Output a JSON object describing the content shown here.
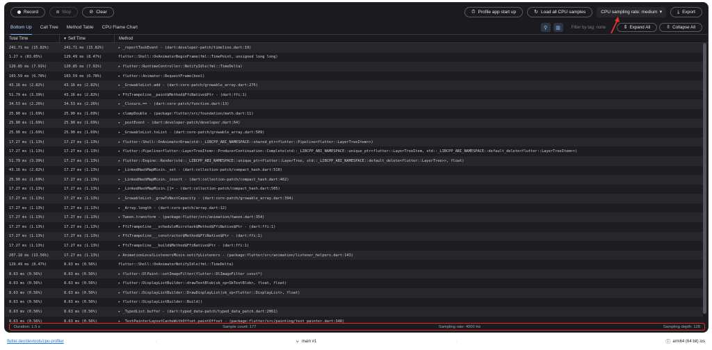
{
  "toolbar": {
    "record": "Record",
    "stop": "Stop",
    "clear": "Clear",
    "profile_startup": "Profile app start up",
    "load_all": "Load all CPU samples",
    "sampling_rate": "CPU sampling rate: medium",
    "export": "Export"
  },
  "tabs": [
    "Bottom Up",
    "Call Tree",
    "Method Table",
    "CPU Flame Chart"
  ],
  "filter": {
    "placeholder": "Filter by tag: none"
  },
  "actions": {
    "expand_all": "Expand All",
    "collapse_all": "Collapse All"
  },
  "columns": {
    "total": "Total Time",
    "self": "Self Time",
    "method": "Method"
  },
  "rows": [
    {
      "total": "241.71 ms (15.82%)",
      "self": "241.71 ms (15.82%)",
      "method": "▸ _reportTaskEvent - (dart:developer-patch/timeline.dart:19)"
    },
    {
      "total": "1.27 s (83.05%)",
      "self": "129.49 ms (8.47%)",
      "method": "  flutter::Shell::OnAnimatorBeginFrame(fml::TimePoint, unsigned long long)"
    },
    {
      "total": "120.85 ms (7.91%)",
      "self": "120.85 ms (7.91%)",
      "method": "▸ flutter::RuntimeController::NotifyIdle(fml::TimeDelta)"
    },
    {
      "total": "103.59 ms (6.78%)",
      "self": "103.59 ms (6.78%)",
      "method": "▸ flutter::Animator::RequestFrame(bool)"
    },
    {
      "total": "43.16 ms (2.82%)",
      "self": "43.16 ms (2.82%)",
      "method": "▸ _GrowableList.add - (dart:core-patch/growable_array.dart:275)"
    },
    {
      "total": "51.79 ms (3.39%)",
      "self": "43.16 ms (2.82%)",
      "method": "▸ FfiTrampoline__paint$Method$FfiNative$Ptr - (dart:ffi:1)"
    },
    {
      "total": "34.53 ms (2.26%)",
      "self": "34.53 ms (2.26%)",
      "method": "▸ _Closure.== - (dart:core-patch/function.dart:13)"
    },
    {
      "total": "25.90 ms (1.69%)",
      "self": "25.90 ms (1.69%)",
      "method": "▸ clampDouble - (package:flutter/src/foundation/math.dart:11)"
    },
    {
      "total": "25.90 ms (1.69%)",
      "self": "25.90 ms (1.69%)",
      "method": "▸ _postEvent - (dart:developer-patch/developer.dart:64)"
    },
    {
      "total": "25.90 ms (1.69%)",
      "self": "25.90 ms (1.69%)",
      "method": "▸ _GrowableList.toList - (dart:core-patch/growable_array.dart:509)"
    },
    {
      "total": "17.27 ms (1.13%)",
      "self": "17.27 ms (1.13%)",
      "method": "▸ flutter::Shell::OnAnimatorDraw(std::_LIBCPP_ABI_NAMESPACE::shared_ptr<flutter::Pipeline<flutter::LayerTreeItem>>)"
    },
    {
      "total": "17.27 ms (1.13%)",
      "self": "17.27 ms (1.13%)",
      "method": "▸ flutter::Pipeline<flutter::LayerTreeItem>::ProducerContinuation::Complete(std::_LIBCPP_ABI_NAMESPACE::unique_ptr<flutter::LayerTreeItem, std::_LIBCPP_ABI_NAMESPACE::default_delete<flutter::LayerTreeItem>>)"
    },
    {
      "total": "51.79 ms (3.39%)",
      "self": "17.27 ms (1.13%)",
      "method": "▸ flutter::Engine::Render(std::_LIBCPP_ABI_NAMESPACE::unique_ptr<flutter::LayerTree, std::_LIBCPP_ABI_NAMESPACE::default_delete<flutter::LayerTree>>, float)"
    },
    {
      "total": "43.16 ms (2.82%)",
      "self": "17.27 ms (1.13%)",
      "method": "▸ _LinkedHashMapMixin._set - (dart:collection-patch/compact_hash.dart:510)"
    },
    {
      "total": "25.90 ms (1.69%)",
      "self": "17.27 ms (1.13%)",
      "method": "▸ _LinkedHashMapMixin._insert - (dart:collection-patch/compact_hash.dart:462)"
    },
    {
      "total": "17.27 ms (1.13%)",
      "self": "17.27 ms (1.13%)",
      "method": "▸ _LinkedHashMapMixin.[]= - (dart:collection-patch/compact_hash.dart:505)"
    },
    {
      "total": "17.27 ms (1.13%)",
      "self": "17.27 ms (1.13%)",
      "method": "▸ _GrowableList._growToNextCapacity - (dart:core-patch/growable_array.dart:394)"
    },
    {
      "total": "17.27 ms (1.13%)",
      "self": "17.27 ms (1.13%)",
      "method": "▸ _Array.length - (dart:core-patch/array.dart:12)"
    },
    {
      "total": "17.27 ms (1.13%)",
      "self": "17.27 ms (1.13%)",
      "method": "▸ Tween.transform - (package:flutter/src/animation/tween.dart:354)"
    },
    {
      "total": "17.27 ms (1.13%)",
      "self": "17.27 ms (1.13%)",
      "method": "▸ FfiTrampoline___scheduleMicrotask$Method$FfiNative$Ptr - (dart:ffi:1)"
    },
    {
      "total": "17.27 ms (1.13%)",
      "self": "17.27 ms (1.13%)",
      "method": "▸ FfiTrampoline___constructor$Method$FfiNative$Ptr - (dart:ffi:1)"
    },
    {
      "total": "17.27 ms (1.13%)",
      "self": "17.27 ms (1.13%)",
      "method": "▸ FfiTrampoline___build$Method$FfiNative$Ptr - (dart:ffi:1)"
    },
    {
      "total": "207.18 ms (13.56%)",
      "self": "17.27 ms (1.13%)",
      "method": "▸ AnimationLocalListenersMixin.notifyListeners - (package:flutter/src/animation/listener_helpers.dart:143)"
    },
    {
      "total": "129.49 ms (8.47%)",
      "self": "8.63 ms (0.56%)",
      "method": "  flutter::Shell::OnAnimatorNotifyIdle(fml::TimeDelta)"
    },
    {
      "total": "8.63 ms (0.56%)",
      "self": "8.63 ms (0.56%)",
      "method": "▸ flutter::DlPaint::setImageFilter(flutter::DlImageFilter const*)"
    },
    {
      "total": "8.63 ms (0.56%)",
      "self": "8.63 ms (0.56%)",
      "method": "▸ flutter::DisplayListBuilder::drawTextBlob(sk_sp<SkTextBlob>, float, float)"
    },
    {
      "total": "8.63 ms (0.56%)",
      "self": "8.63 ms (0.56%)",
      "method": "▸ flutter::DisplayListBuilder::DrawDisplayList(sk_sp<flutter::DisplayList>, float)"
    },
    {
      "total": "8.63 ms (0.56%)",
      "self": "8.63 ms (0.56%)",
      "method": "▸ flutter::DisplayListBuilder::Build()"
    },
    {
      "total": "8.63 ms (0.56%)",
      "self": "8.63 ms (0.56%)",
      "method": "▸ _TypedList.buffer - (dart:typed_data-patch/typed_data_patch.dart:2061)"
    },
    {
      "total": "8.63 ms (0.56%)",
      "self": "8.63 ms (0.56%)",
      "method": "▸ _TextPainterLayoutCacheWithOffset.paintOffset - (package:flutter/src/painting/text_painter.dart:348)"
    }
  ],
  "status": {
    "duration": "Duration: 1.5 s",
    "sample_count": "Sample count: 177",
    "sampling_rate": "Sampling rate: 4000 Hz",
    "sampling_depth": "Sampling depth: 128"
  },
  "footer": {
    "link": "flutter.dev/devtools/cpu-profiler",
    "dot1": "·",
    "branch": "main #1",
    "dot2": "·",
    "arch": "arm64 (64 bit) ios"
  },
  "colors": {
    "accent": "#8cb4ff",
    "highlight": "#e0302f"
  }
}
